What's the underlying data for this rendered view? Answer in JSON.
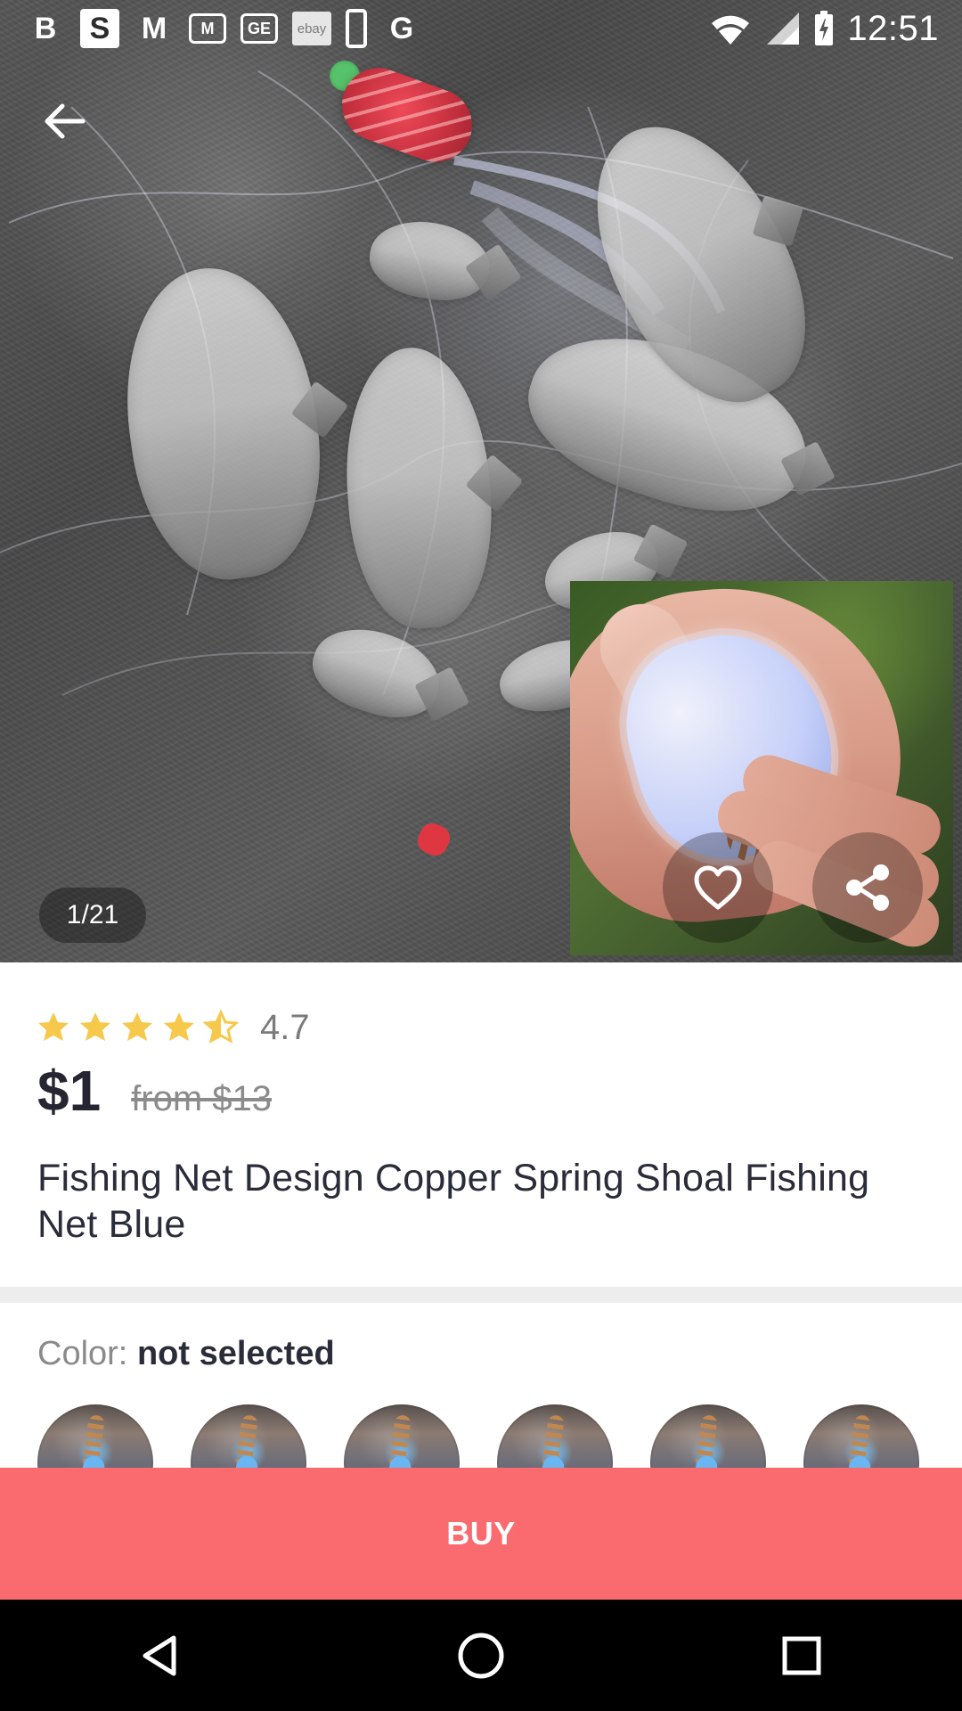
{
  "status_bar": {
    "apps": [
      "B",
      "S",
      "M",
      "M",
      "GE",
      "ebay",
      "",
      "G"
    ],
    "time": "12:51"
  },
  "gallery": {
    "counter": "1/21"
  },
  "product": {
    "rating_value": "4.7",
    "rating_fraction": 0.94,
    "price_current": "$1",
    "price_original": "from $13",
    "title": "Fishing Net Design Copper Spring Shoal Fishing Net Blue"
  },
  "options": {
    "color_label": "Color:",
    "color_value": "not selected"
  },
  "actions": {
    "buy_label": "BUY"
  },
  "icons": {
    "back": "back-arrow-icon",
    "favorite": "heart-icon",
    "share": "share-icon",
    "star": "star-icon",
    "nav_back": "nav-back-icon",
    "nav_home": "nav-home-icon",
    "nav_recents": "nav-recents-icon"
  },
  "colors": {
    "buy_button": "#fa6b6f",
    "star": "#f6c94d",
    "title_text": "#2a2c3a",
    "muted_text": "#8a8a8a"
  }
}
